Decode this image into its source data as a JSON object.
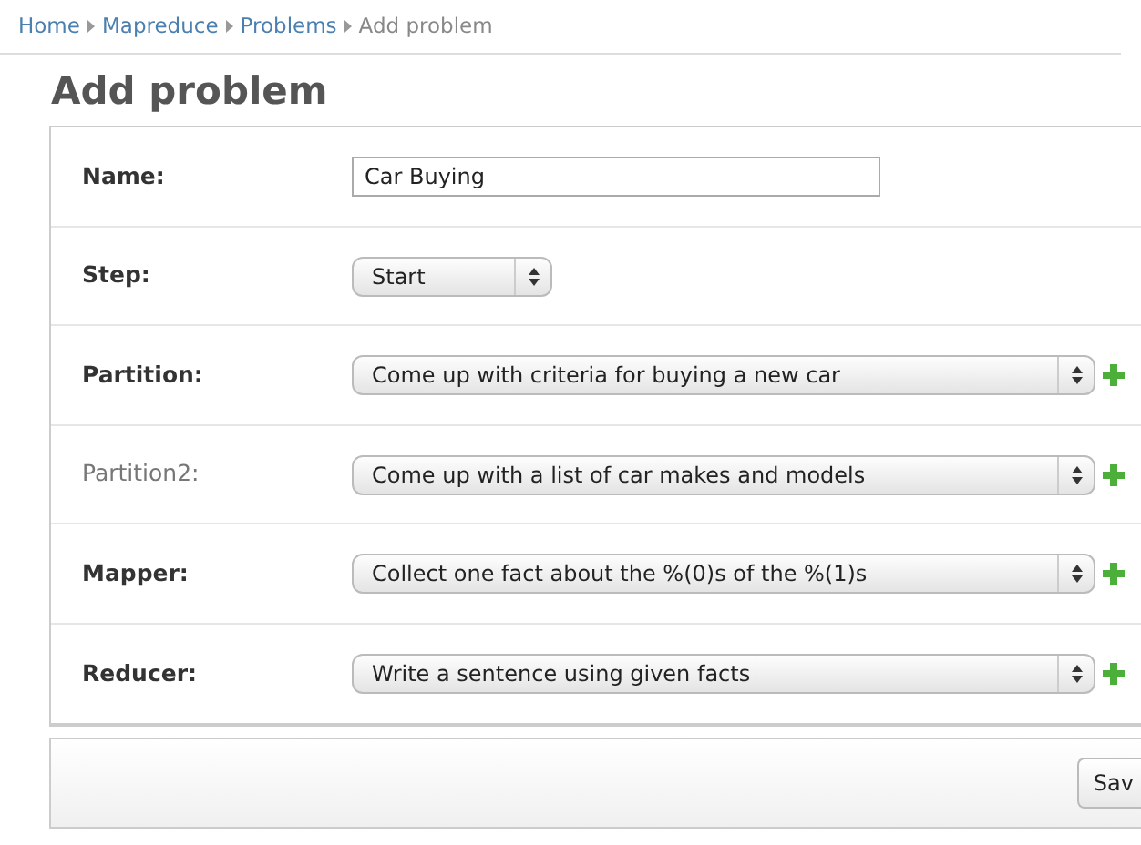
{
  "breadcrumbs": [
    {
      "label": "Home",
      "current": false
    },
    {
      "label": "Mapreduce",
      "current": false
    },
    {
      "label": "Problems",
      "current": false
    },
    {
      "label": "Add problem",
      "current": true
    }
  ],
  "title": "Add problem",
  "fields": [
    {
      "label": "Name:",
      "required": true,
      "kind": "text",
      "value": "Car Buying",
      "add_button": false
    },
    {
      "label": "Step:",
      "required": true,
      "kind": "select",
      "value": "Start",
      "add_button": false
    },
    {
      "label": "Partition:",
      "required": true,
      "kind": "select",
      "value": "Come up with criteria for buying a new car",
      "add_button": true
    },
    {
      "label": "Partition2:",
      "required": false,
      "kind": "select",
      "value": "Come up with a list of car makes and models",
      "add_button": true
    },
    {
      "label": "Mapper:",
      "required": true,
      "kind": "select",
      "value": "Collect one fact about the %(0)s of the %(1)s",
      "add_button": true
    },
    {
      "label": "Reducer:",
      "required": true,
      "kind": "select",
      "value": "Write a sentence using given facts",
      "add_button": true
    }
  ],
  "submit": {
    "label": "Sav"
  }
}
